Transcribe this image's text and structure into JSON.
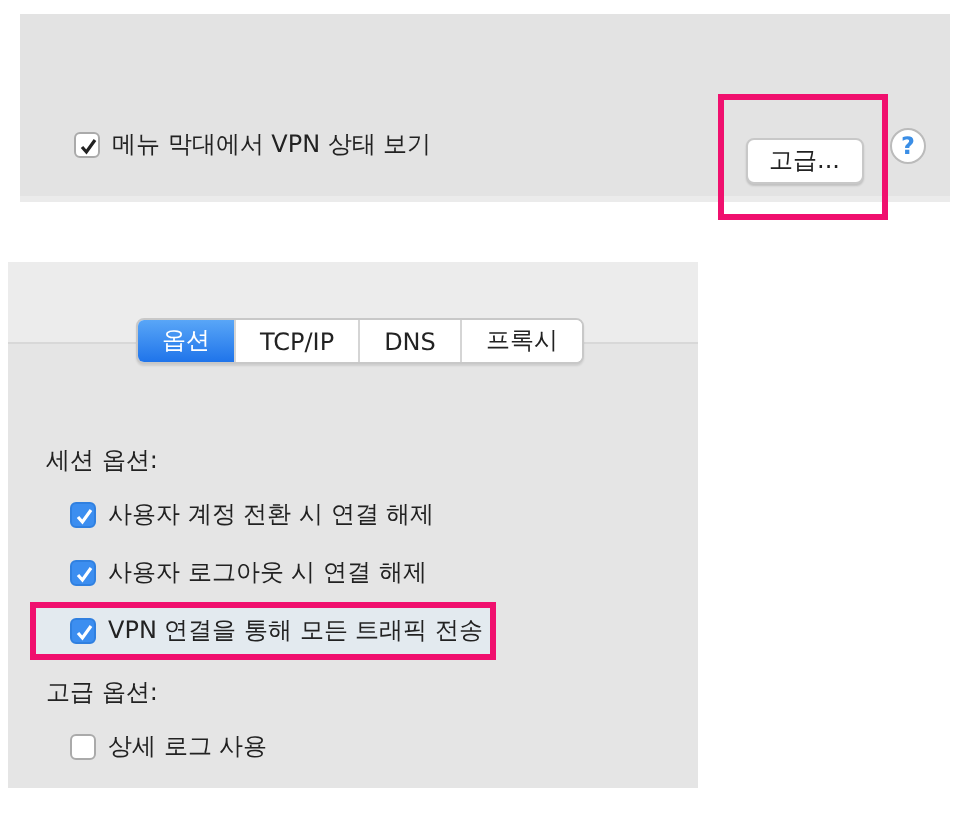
{
  "top_panel": {
    "menu_bar_checkbox": {
      "label": "메뉴 막대에서 VPN 상태 보기",
      "checked": true
    },
    "advanced_button": {
      "label": "고급...",
      "highlighted": true
    },
    "help_button": {
      "label": "?"
    }
  },
  "advanced_panel": {
    "tabs": [
      {
        "label": "옵션",
        "selected": true
      },
      {
        "label": "TCP/IP",
        "selected": false
      },
      {
        "label": "DNS",
        "selected": false
      },
      {
        "label": "프록시",
        "selected": false
      }
    ],
    "sections": [
      {
        "title": "세션 옵션:",
        "options": [
          {
            "label": "사용자 계정 전환 시 연결 해제",
            "checked": true,
            "highlighted": false
          },
          {
            "label": "사용자 로그아웃 시 연결 해제",
            "checked": true,
            "highlighted": false
          },
          {
            "label": "VPN 연결을 통해 모든 트래픽 전송",
            "checked": true,
            "highlighted": true
          }
        ]
      },
      {
        "title": "고급 옵션:",
        "options": [
          {
            "label": "상세 로그 사용",
            "checked": false,
            "highlighted": false
          }
        ]
      }
    ]
  }
}
